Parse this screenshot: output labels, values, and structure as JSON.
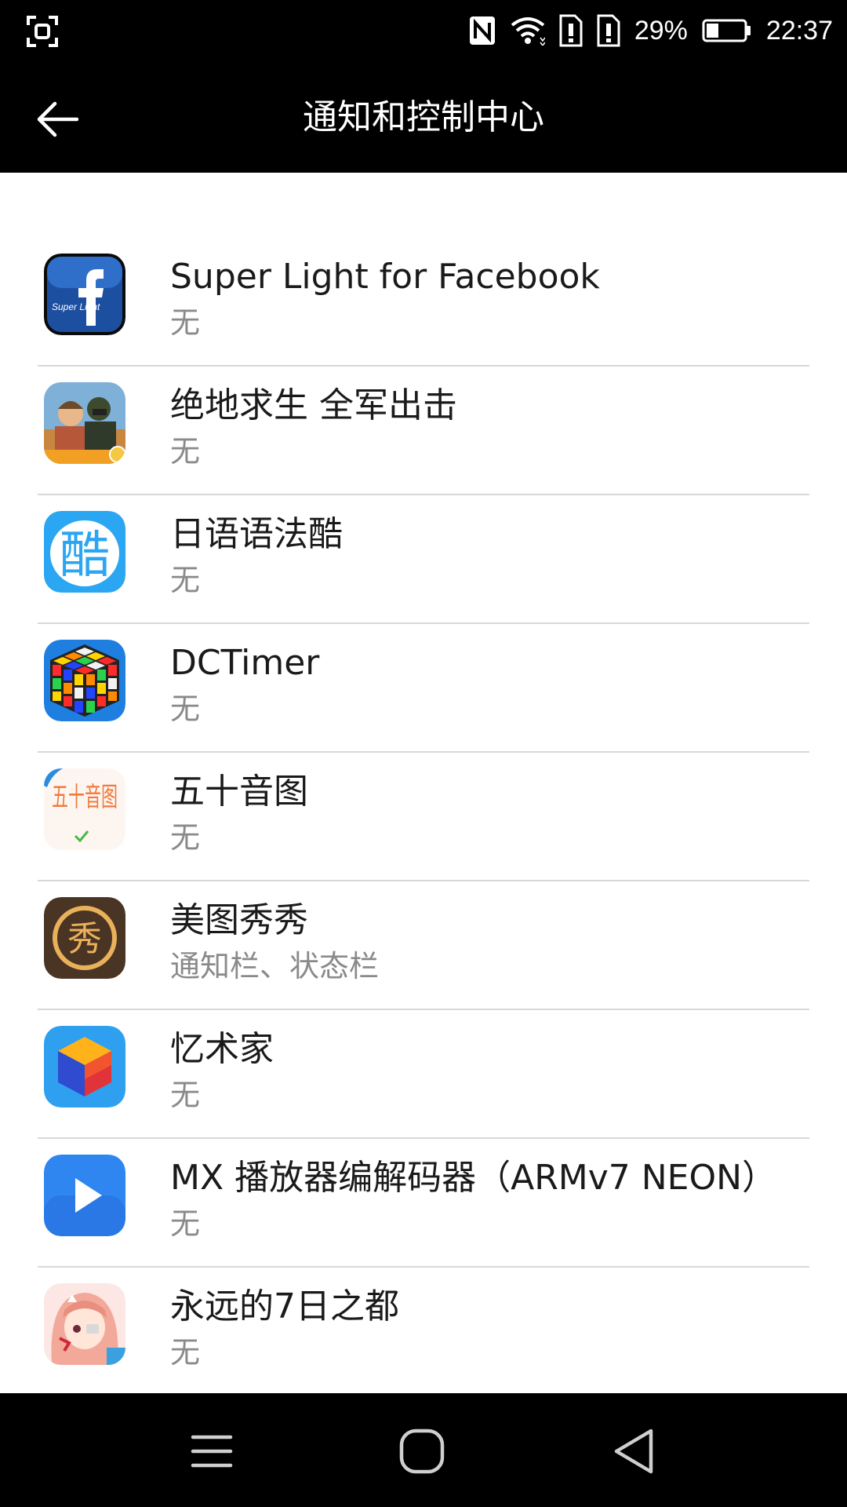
{
  "status_bar": {
    "battery": "29%",
    "time": "22:37"
  },
  "app_bar": {
    "title": "通知和控制中心"
  },
  "apps": [
    {
      "name": "Super Light for Facebook",
      "status": "无",
      "icon": "super-light-facebook-icon",
      "icon_text": "Super Light"
    },
    {
      "name": "绝地求生 全军出击",
      "status": "无",
      "icon": "pubg-icon"
    },
    {
      "name": "日语语法酷",
      "status": "无",
      "icon": "japanese-grammar-icon",
      "icon_text": "酷"
    },
    {
      "name": "DCTimer",
      "status": "无",
      "icon": "rubiks-cube-icon"
    },
    {
      "name": "五十音图",
      "status": "无",
      "icon": "gojuon-icon",
      "icon_text": "五十音图"
    },
    {
      "name": "美图秀秀",
      "status": "通知栏、状态栏",
      "icon": "meitu-icon",
      "icon_text": "秀"
    },
    {
      "name": "忆术家",
      "status": "无",
      "icon": "yishujia-cube-icon"
    },
    {
      "name": "MX 播放器编解码器（ARMv7 NEON）",
      "status": "无",
      "icon": "mx-player-icon"
    },
    {
      "name": "永远的7日之都",
      "status": "无",
      "icon": "anime-girl-icon"
    }
  ],
  "colors": {
    "bar_bg": "#000000",
    "list_bg": "#ffffff",
    "divider": "#d8d8d8",
    "name_text": "#1a1a1a",
    "status_text": "#8a8a8a"
  }
}
